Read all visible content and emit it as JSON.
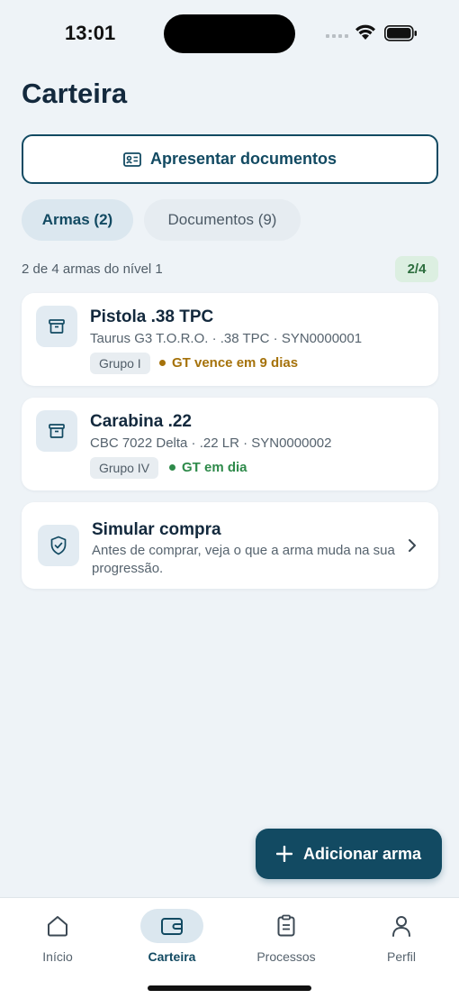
{
  "status_bar": {
    "time": "13:01"
  },
  "page": {
    "title": "Carteira"
  },
  "present_button": {
    "label": "Apresentar documentos",
    "icon": "id-card-icon"
  },
  "tabs": [
    {
      "label": "Armas (2)",
      "active": true
    },
    {
      "label": "Documentos (9)",
      "active": false
    }
  ],
  "level": {
    "text": "2 de 4 armas do nível 1",
    "badge": "2/4"
  },
  "weapons": [
    {
      "name": "Pistola .38 TPC",
      "details": "Taurus G3 T.O.R.O. · .38 TPC · SYN0000001",
      "group": "Grupo I",
      "status": "GT vence em 9 dias",
      "status_color": "#a5720b",
      "icon": "archive-box-icon"
    },
    {
      "name": "Carabina .22",
      "details": "CBC 7022 Delta · .22 LR · SYN0000002",
      "group": "Grupo IV",
      "status": "GT em dia",
      "status_color": "#2e8a4a",
      "icon": "archive-box-icon"
    }
  ],
  "simulate": {
    "title": "Simular compra",
    "description": "Antes de comprar, veja o que a arma muda na sua progressão.",
    "icon": "shield-check-icon"
  },
  "fab": {
    "label": "Adicionar arma",
    "icon": "plus-icon"
  },
  "nav": [
    {
      "label": "Início",
      "icon": "home-icon",
      "active": false
    },
    {
      "label": "Carteira",
      "icon": "wallet-icon",
      "active": true
    },
    {
      "label": "Processos",
      "icon": "clipboard-icon",
      "active": false
    },
    {
      "label": "Perfil",
      "icon": "user-icon",
      "active": false
    }
  ],
  "colors": {
    "primary": "#124a62",
    "background": "#eef3f7",
    "success": "#2e8a4a",
    "warning": "#a5720b"
  }
}
